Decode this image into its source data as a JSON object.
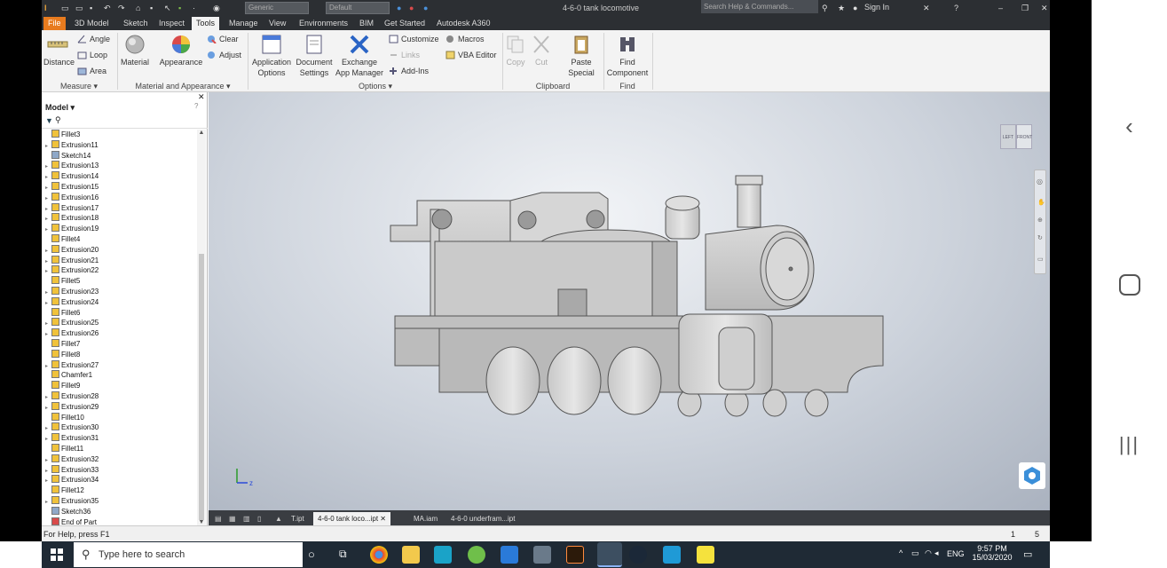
{
  "window": {
    "title": "4-6-0 tank locomotive",
    "search_placeholder": "Search Help & Commands...",
    "sign_in": "Sign In",
    "appearance_combo": "Generic",
    "material_combo": "Default"
  },
  "menu": {
    "tabs": [
      "File",
      "3D Model",
      "Sketch",
      "Inspect",
      "Tools",
      "Manage",
      "View",
      "Environments",
      "BIM",
      "Get Started",
      "Autodesk A360"
    ],
    "active": "Tools"
  },
  "ribbon": {
    "measure": {
      "distance": "Distance",
      "angle": "Angle",
      "loop": "Loop",
      "area": "Area",
      "group": "Measure ▾"
    },
    "material_appearance": {
      "material": "Material",
      "appearance": "Appearance",
      "clear": "Clear",
      "adjust": "Adjust",
      "group": "Material and Appearance ▾"
    },
    "options": {
      "app_options": [
        "Application",
        "Options"
      ],
      "doc_settings": [
        "Document",
        "Settings"
      ],
      "exchange": [
        "Exchange",
        "App Manager"
      ],
      "customize": "Customize",
      "links": "Links",
      "addins": "Add-Ins",
      "macros": "Macros",
      "vba": "VBA Editor",
      "group": "Options ▾"
    },
    "clipboard": {
      "copy": "Copy",
      "cut": "Cut",
      "paste": [
        "Paste",
        "Special"
      ],
      "group": "Clipboard"
    },
    "find": {
      "find": [
        "Find",
        "Component"
      ],
      "group": "Find"
    }
  },
  "browser": {
    "title": "Model ▾",
    "items": [
      {
        "label": "Fillet3",
        "type": "fillet",
        "expand": false
      },
      {
        "label": "Extrusion11",
        "type": "extrusion",
        "expand": true
      },
      {
        "label": "Sketch14",
        "type": "sketch",
        "expand": false
      },
      {
        "label": "Extrusion13",
        "type": "extrusion",
        "expand": true
      },
      {
        "label": "Extrusion14",
        "type": "extrusion",
        "expand": true
      },
      {
        "label": "Extrusion15",
        "type": "extrusion",
        "expand": true
      },
      {
        "label": "Extrusion16",
        "type": "extrusion",
        "expand": true
      },
      {
        "label": "Extrusion17",
        "type": "extrusion",
        "expand": true
      },
      {
        "label": "Extrusion18",
        "type": "extrusion",
        "expand": true
      },
      {
        "label": "Extrusion19",
        "type": "extrusion",
        "expand": true
      },
      {
        "label": "Fillet4",
        "type": "fillet",
        "expand": false
      },
      {
        "label": "Extrusion20",
        "type": "extrusion",
        "expand": true
      },
      {
        "label": "Extrusion21",
        "type": "extrusion",
        "expand": true
      },
      {
        "label": "Extrusion22",
        "type": "extrusion",
        "expand": true
      },
      {
        "label": "Fillet5",
        "type": "fillet",
        "expand": false
      },
      {
        "label": "Extrusion23",
        "type": "extrusion",
        "expand": true
      },
      {
        "label": "Extrusion24",
        "type": "extrusion",
        "expand": true
      },
      {
        "label": "Fillet6",
        "type": "fillet",
        "expand": false
      },
      {
        "label": "Extrusion25",
        "type": "extrusion",
        "expand": true
      },
      {
        "label": "Extrusion26",
        "type": "extrusion",
        "expand": true
      },
      {
        "label": "Fillet7",
        "type": "fillet",
        "expand": false
      },
      {
        "label": "Fillet8",
        "type": "fillet",
        "expand": false
      },
      {
        "label": "Extrusion27",
        "type": "extrusion",
        "expand": true
      },
      {
        "label": "Chamfer1",
        "type": "chamfer",
        "expand": false
      },
      {
        "label": "Fillet9",
        "type": "fillet",
        "expand": false
      },
      {
        "label": "Extrusion28",
        "type": "extrusion",
        "expand": true
      },
      {
        "label": "Extrusion29",
        "type": "extrusion",
        "expand": true
      },
      {
        "label": "Fillet10",
        "type": "fillet",
        "expand": false
      },
      {
        "label": "Extrusion30",
        "type": "extrusion",
        "expand": true
      },
      {
        "label": "Extrusion31",
        "type": "extrusion",
        "expand": true
      },
      {
        "label": "Fillet11",
        "type": "fillet",
        "expand": false
      },
      {
        "label": "Extrusion32",
        "type": "extrusion",
        "expand": true
      },
      {
        "label": "Extrusion33",
        "type": "extrusion",
        "expand": true
      },
      {
        "label": "Extrusion34",
        "type": "extrusion",
        "expand": true
      },
      {
        "label": "Fillet12",
        "type": "fillet",
        "expand": false
      },
      {
        "label": "Extrusion35",
        "type": "extrusion",
        "expand": true
      },
      {
        "label": "Sketch36",
        "type": "sketch",
        "expand": false
      },
      {
        "label": "End of Part",
        "type": "end",
        "expand": false
      }
    ]
  },
  "viewcube": {
    "left": "LEFT",
    "front": "FRONT"
  },
  "doc_tabs": [
    {
      "label": "T.ipt",
      "active": false
    },
    {
      "label": "4-6-0 tank loco...ipt",
      "active": true
    },
    {
      "label": "MA.iam",
      "active": false
    },
    {
      "label": "4-6-0 underfram...ipt",
      "active": false
    }
  ],
  "status": {
    "help": "For Help, press F1",
    "count1": "1",
    "count2": "5"
  },
  "taskbar": {
    "search": "Type here to search",
    "lang": "ENG",
    "time": "9:57 PM",
    "date": "15/03/2020"
  },
  "axis": {
    "z": "z"
  }
}
